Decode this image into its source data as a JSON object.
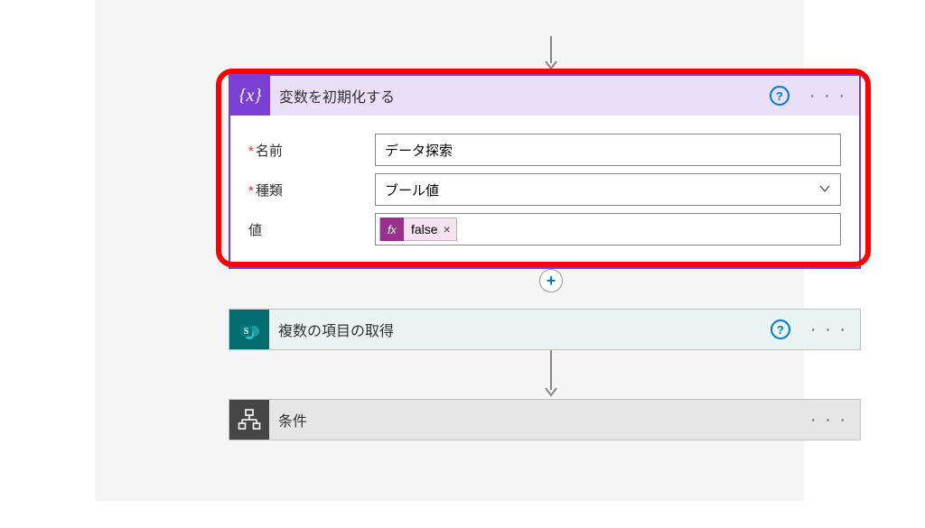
{
  "variable_card": {
    "title": "変数を初期化する",
    "fields": {
      "name_label": "名前",
      "name_value": "データ探索",
      "type_label": "種類",
      "type_value": "ブール値",
      "value_label": "値",
      "value_token": "false"
    }
  },
  "get_items_card": {
    "title": "複数の項目の取得"
  },
  "condition_card": {
    "title": "条件"
  },
  "icons": {
    "variable": "{x}",
    "sharepoint": "S",
    "fx": "fx",
    "help": "?",
    "more": "· · ·",
    "plus": "+",
    "remove": "×"
  }
}
